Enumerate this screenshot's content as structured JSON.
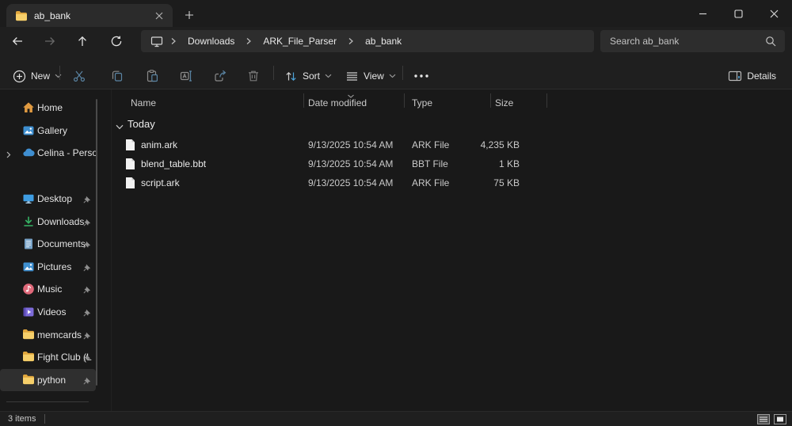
{
  "window": {
    "tab_title": "ab_bank"
  },
  "nav": {
    "breadcrumb": [
      "Downloads",
      "ARK_File_Parser",
      "ab_bank"
    ],
    "search_placeholder": "Search ab_bank"
  },
  "toolbar": {
    "new_label": "New",
    "sort_label": "Sort",
    "view_label": "View",
    "details_label": "Details"
  },
  "sidebar": {
    "top_items": [
      {
        "label": "Home"
      },
      {
        "label": "Gallery"
      },
      {
        "label": "Celina - Persona"
      }
    ],
    "pinned_items": [
      {
        "label": "Desktop"
      },
      {
        "label": "Downloads"
      },
      {
        "label": "Documents"
      },
      {
        "label": "Pictures"
      },
      {
        "label": "Music"
      },
      {
        "label": "Videos"
      },
      {
        "label": "memcards"
      },
      {
        "label": "Fight Club (L"
      },
      {
        "label": "python"
      }
    ],
    "selected_item": "python"
  },
  "files": {
    "columns": {
      "name": "Name",
      "date": "Date modified",
      "type": "Type",
      "size": "Size"
    },
    "sorted_column": "Date modified",
    "group_label": "Today",
    "rows": [
      {
        "name": "anim.ark",
        "date_modified": "9/13/2025 10:54 AM",
        "type": "ARK File",
        "size": "4,235 KB"
      },
      {
        "name": "blend_table.bbt",
        "date_modified": "9/13/2025 10:54 AM",
        "type": "BBT File",
        "size": "1 KB"
      },
      {
        "name": "script.ark",
        "date_modified": "9/13/2025 10:54 AM",
        "type": "ARK File",
        "size": "75 KB"
      }
    ]
  },
  "statusbar": {
    "item_count": "3 items"
  },
  "colors": {
    "window_bg": "#191919",
    "titlebar_bg": "#1c1c1c",
    "band_bg": "#1f1f1f",
    "field_bg": "#2d2d2d",
    "accent_blue": "#4da3d9",
    "steel_blue": "#5a84a3",
    "folder_yellow": "#f6cf6a",
    "downloads_green": "#35b264",
    "home_orange": "#e09a41",
    "music_pink": "#e0697a",
    "videos_purple": "#7d6bd9"
  }
}
